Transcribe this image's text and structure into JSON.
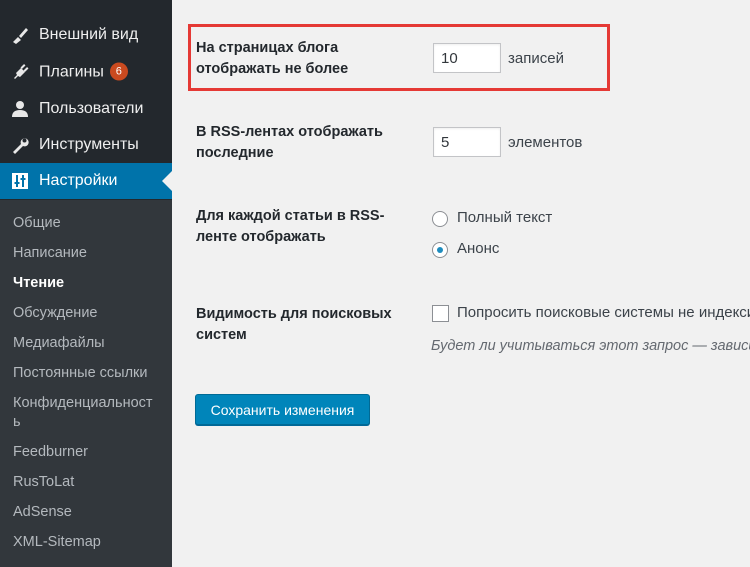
{
  "sidebar": {
    "menu": [
      {
        "label": "Внешний вид",
        "icon": "paintbrush-icon"
      },
      {
        "label": "Плагины",
        "icon": "plugin-icon",
        "badge": "6"
      },
      {
        "label": "Пользователи",
        "icon": "user-icon"
      },
      {
        "label": "Инструменты",
        "icon": "wrench-icon"
      },
      {
        "label": "Настройки",
        "icon": "settings-sliders-icon",
        "active": true
      }
    ],
    "submenu": [
      "Общие",
      "Написание",
      "Чтение",
      "Обсуждение",
      "Медиафайлы",
      "Постоянные ссылки",
      "Конфиденциальност",
      "ь",
      "Feedburner",
      "RusToLat",
      "AdSense",
      "XML-Sitemap"
    ],
    "current_submenu": "Чтение"
  },
  "form": {
    "posts_per_page": {
      "label": "На страницах блога отображать не более",
      "value": "10",
      "suffix": "записей"
    },
    "posts_per_rss": {
      "label": "В RSS-лентах отображать последние",
      "value": "5",
      "suffix": "элементов"
    },
    "rss_use_excerpt": {
      "label": "Для каждой статьи в RSS-ленте отображать",
      "options": [
        "Полный текст",
        "Анонс"
      ],
      "selected": "Анонс"
    },
    "search_visibility": {
      "label": "Видимость для поисковых систем",
      "checkbox_label": "Попросить поисковые системы не индексировать сайт",
      "checked": false,
      "description": "Будет ли учитываться этот запрос — зависит от поисковых систем."
    },
    "save_label": "Сохранить изменения"
  },
  "colors": {
    "sidebar_bg": "#23282d",
    "submenu_bg": "#32373c",
    "accent": "#0073aa",
    "badge": "#ca4a1f",
    "highlight_border": "#e53935",
    "button": "#0085ba"
  }
}
